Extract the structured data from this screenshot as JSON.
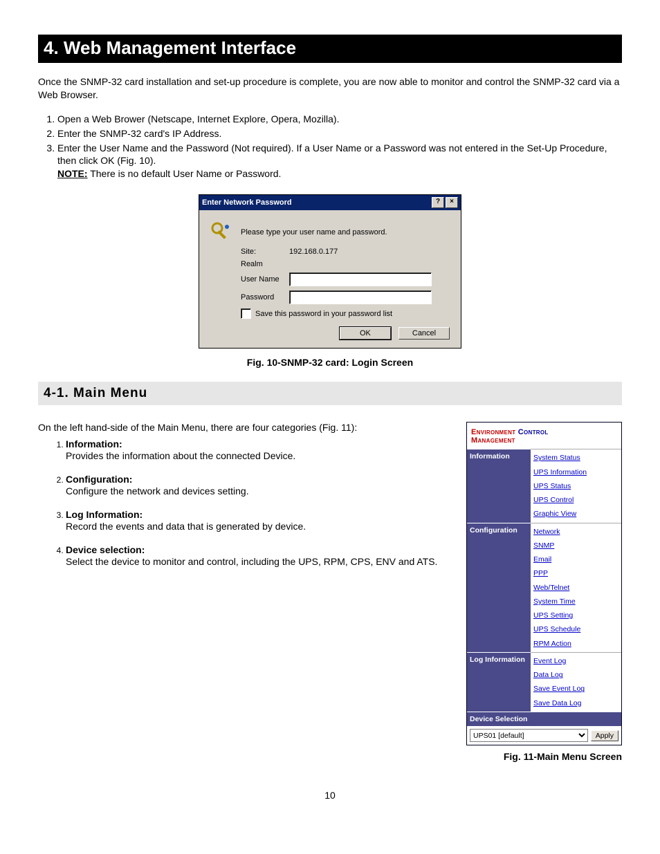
{
  "chapter": "4.    Web Management Interface",
  "intro": "Once the SNMP-32 card installation and set-up procedure is complete, you are now able to monitor and control the SNMP-32 card via a Web Browser.",
  "steps": [
    "Open a Web Brower (Netscape, Internet Explore, Opera, Mozilla).",
    "Enter the SNMP-32 card's IP Address.",
    "Enter the User Name and the Password (Not required).  If a User Name or a Password was not entered in the Set-Up Procedure, then click OK (Fig. 10)."
  ],
  "note_label": "NOTE:",
  "note_text": "  There is no default User Name or Password.",
  "dialog": {
    "title": "Enter Network Password",
    "help": "?",
    "close": "×",
    "prompt": "Please type your user name and password.",
    "site_label": "Site:",
    "site_value": "192.168.0.177",
    "realm_label": "Realm",
    "user_label": "User Name",
    "user_value": "",
    "pass_label": "Password",
    "pass_value": "",
    "save_label": "Save this password in your password list",
    "ok": "OK",
    "cancel": "Cancel"
  },
  "fig10_caption": "Fig. 10-SNMP-32 card: Login Screen",
  "section": "4-1.  Main Menu",
  "section_intro": "On the left hand-side of the Main Menu, there are four categories (Fig. 11):",
  "defs": [
    {
      "term": "Information:",
      "desc": "Provides the information about the connected Device."
    },
    {
      "term": "Configuration:",
      "desc": "Configure the network and devices setting."
    },
    {
      "term": "Log Information:",
      "desc": "Record the events and data that is generated by device."
    },
    {
      "term": "Device selection:",
      "desc": "Select the device to monitor and control, including the UPS, RPM, CPS, ENV and ATS."
    }
  ],
  "menu": {
    "title_env": "Environment ",
    "title_ctrl": "Control",
    "title_mgmt": "Management",
    "groups": [
      {
        "head": "Information",
        "links": [
          "System Status",
          "UPS Information",
          "UPS Status",
          "UPS Control",
          "Graphic View"
        ]
      },
      {
        "head": "Configuration",
        "links": [
          "Network",
          "SNMP",
          "Email",
          "PPP",
          "Web/Telnet",
          "System Time",
          "UPS Setting",
          "UPS Schedule",
          "RPM Action"
        ]
      },
      {
        "head": "Log Information",
        "links": [
          "Event Log",
          "Data Log",
          "Save Event Log",
          "Save Data Log"
        ]
      }
    ],
    "device_head": "Device Selection",
    "device_value": "UPS01 [default]",
    "apply": "Apply"
  },
  "fig11_caption": "Fig. 11-Main Menu Screen",
  "page_number": "10"
}
